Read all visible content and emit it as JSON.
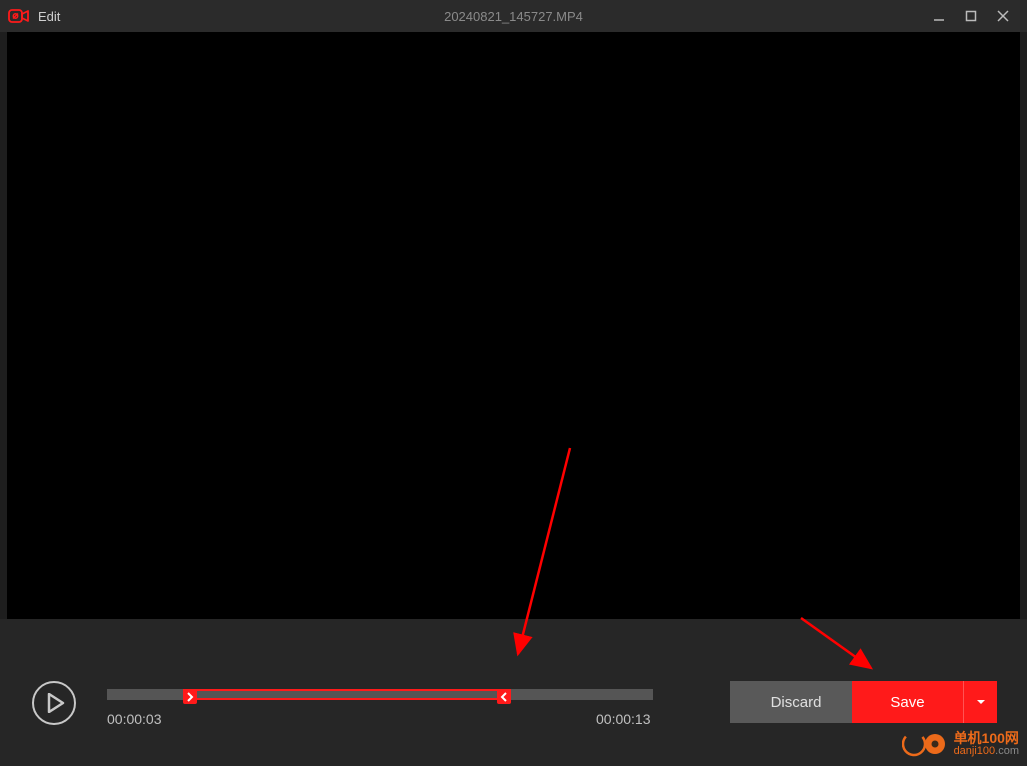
{
  "titlebar": {
    "app_label": "Edit",
    "filename": "20240821_145727.MP4"
  },
  "timeline": {
    "start_time": "00:00:03",
    "end_time": "00:00:13",
    "trim_start_pct": 14,
    "trim_end_pct": 74
  },
  "buttons": {
    "discard": "Discard",
    "save": "Save"
  },
  "watermark": {
    "line1": "单机100网",
    "line2_a": "danji100",
    "line2_b": ".com"
  },
  "colors": {
    "accent": "#ff1a1a",
    "bg_dark": "#1e1e1e",
    "bg_panel": "#262626",
    "btn_grey": "#595959"
  }
}
